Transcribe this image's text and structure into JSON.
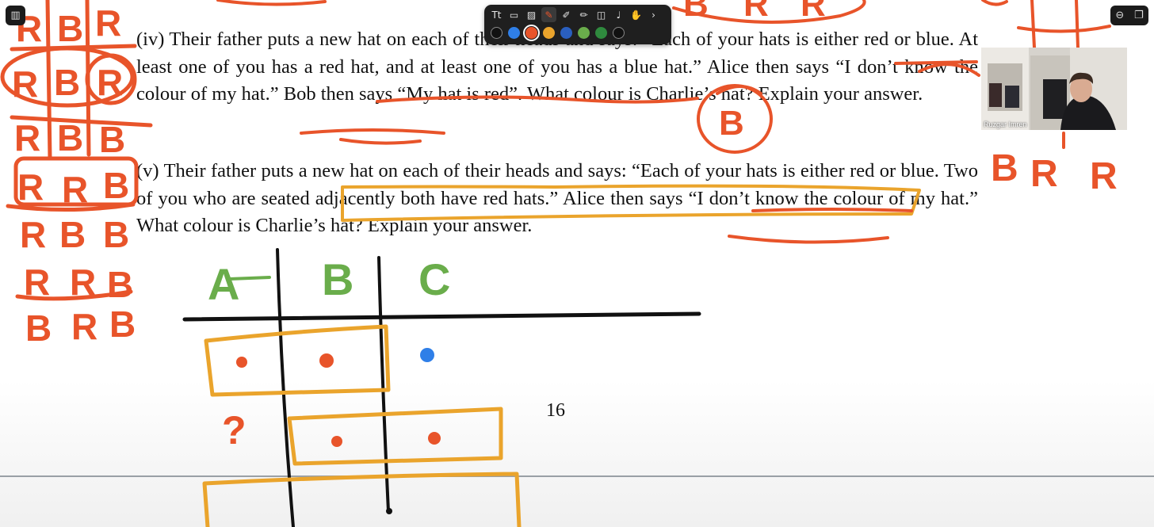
{
  "document": {
    "para_iv_prefix": "(iv)",
    "para_iv_text": "Their father puts a new hat on each of their heads and says: “Each of your hats is either red or blue. At least one of you has a red hat, and at least one of you has a blue hat.” Alice then says “I don’t know the colour of my hat.” Bob then says “My hat is red”. What colour is Charlie’s hat? Explain your answer.",
    "para_v_prefix": "(v)",
    "para_v_text": "Their father puts a new hat on each of their heads and says: “Each of your hats is either red or blue. Two of you who are seated adjacently both have red hats.” Alice then says “I don’t know the colour of my hat.” What colour is Charlie’s hat? Explain your answer.",
    "page_number": "16"
  },
  "annotations": {
    "table_headers": [
      "A",
      "B",
      "C"
    ],
    "side_cases": [
      [
        "R",
        "B",
        "R"
      ],
      [
        "R",
        "B",
        "R"
      ],
      [
        "R",
        "B",
        "B"
      ],
      [
        "R",
        "R",
        "B"
      ],
      [
        "R",
        "B",
        "B"
      ],
      [
        "R",
        "R",
        "B"
      ],
      [
        "B",
        "R",
        "B"
      ]
    ],
    "answer_iv": "B",
    "top_right_letters": [
      "B",
      "R",
      "R"
    ],
    "question_mark": "?",
    "partial_top_letters": [
      "B",
      "R",
      "R"
    ],
    "ink_colors": {
      "orange": "#e8542a",
      "yellow": "#eaa42c",
      "green": "#6aad4b",
      "blue": "#2f7fe8",
      "black": "#111111"
    }
  },
  "toolbar": {
    "tools": [
      "text-tool-icon",
      "shape-tool-icon",
      "image-tool-icon",
      "pen-tool-icon",
      "marker-tool-icon",
      "highlighter-tool-icon",
      "eraser-tool-icon",
      "microphone-icon",
      "lasso-tool-icon",
      "more-tools-icon"
    ],
    "colors": [
      "#111111",
      "#2f7fe8",
      "#e8542a",
      "#eaa42c",
      "#2a5fbf",
      "#6aad4b",
      "#2f8a3e",
      "#111111"
    ],
    "selected_color": "#e8542a"
  },
  "webcam": {
    "name": "Ruzgar Imren"
  }
}
